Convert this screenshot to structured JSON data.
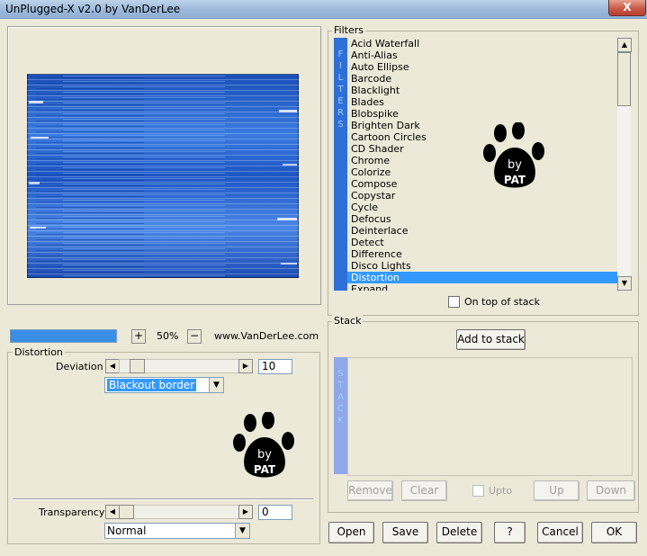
{
  "window": {
    "title": "UnPlugged-X v2.0 by VanDerLee",
    "close_label": "X"
  },
  "preview": {
    "zoom": "50%",
    "zoom_in": "+",
    "zoom_out": "−",
    "website": "www.VanDerLee.com"
  },
  "filter": {
    "group_label": "Distortion",
    "deviation_label": "Deviation",
    "deviation_value": "10",
    "mode_selected": "Blackout border",
    "transparency_label": "Transparency",
    "transparency_value": "0",
    "blend_selected": "Normal"
  },
  "filters": {
    "group_label": "Filters",
    "side_letters": [
      "F",
      "I",
      "L",
      "T",
      "E",
      "R",
      "S"
    ],
    "items": [
      "Acid Waterfall",
      "Anti-Alias",
      "Auto Ellipse",
      "Barcode",
      "Blacklight",
      "Blades",
      "Blobspike",
      "Brighten Dark",
      "Cartoon Circles",
      "CD Shader",
      "Chrome",
      "Colorize",
      "Compose",
      "Copystar",
      "Cycle",
      "Defocus",
      "Deinterlace",
      "Detect",
      "Difference",
      "Disco Lights",
      "Distortion",
      "Expand"
    ],
    "selected": "Distortion",
    "on_top_label": "On top of stack"
  },
  "stack": {
    "group_label": "Stack",
    "add_label": "Add to stack",
    "side_letters": [
      "S",
      "T",
      "A",
      "C",
      "K"
    ],
    "remove_label": "Remove",
    "clear_label": "Clear",
    "upto_label": "Upto",
    "up_label": "Up",
    "down_label": "Down"
  },
  "footer": {
    "open_label": "Open",
    "save_label": "Save",
    "delete_label": "Delete",
    "help_label": "?",
    "cancel_label": "Cancel",
    "ok_label": "OK"
  },
  "logo": {
    "text_by": "by",
    "text_pat": "PAT"
  },
  "colors": {
    "accent": "#3399ff",
    "sidebar": "#2f6fd8",
    "stack_sidebar": "#8fa8e8"
  }
}
